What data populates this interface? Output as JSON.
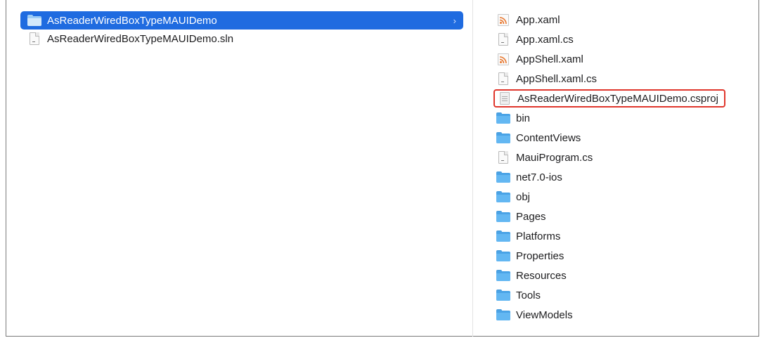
{
  "left_column": {
    "items": [
      {
        "label": "AsReaderWiredBoxTypeMAUIDemo",
        "icon": "folder-icon",
        "selected": true
      },
      {
        "label": "AsReaderWiredBoxTypeMAUIDemo.sln",
        "icon": "file-icon",
        "selected": false
      }
    ]
  },
  "right_column": {
    "items": [
      {
        "label": "App.xaml",
        "icon": "xaml-file-icon"
      },
      {
        "label": "App.xaml.cs",
        "icon": "file-icon"
      },
      {
        "label": "AppShell.xaml",
        "icon": "xaml-file-icon"
      },
      {
        "label": "AppShell.xaml.cs",
        "icon": "file-icon"
      },
      {
        "label": "AsReaderWiredBoxTypeMAUIDemo.csproj",
        "icon": "project-file-icon",
        "highlighted": true
      },
      {
        "label": "bin",
        "icon": "folder-icon"
      },
      {
        "label": "ContentViews",
        "icon": "folder-icon"
      },
      {
        "label": "MauiProgram.cs",
        "icon": "file-icon"
      },
      {
        "label": "net7.0-ios",
        "icon": "folder-icon"
      },
      {
        "label": "obj",
        "icon": "folder-icon"
      },
      {
        "label": "Pages",
        "icon": "folder-icon"
      },
      {
        "label": "Platforms",
        "icon": "folder-icon"
      },
      {
        "label": "Properties",
        "icon": "folder-icon"
      },
      {
        "label": "Resources",
        "icon": "folder-icon"
      },
      {
        "label": "Tools",
        "icon": "folder-icon"
      },
      {
        "label": "ViewModels",
        "icon": "folder-icon"
      }
    ]
  },
  "colors": {
    "selection": "#1f6be0",
    "highlight_border": "#e0362c",
    "folder": "#4aa3e6"
  }
}
